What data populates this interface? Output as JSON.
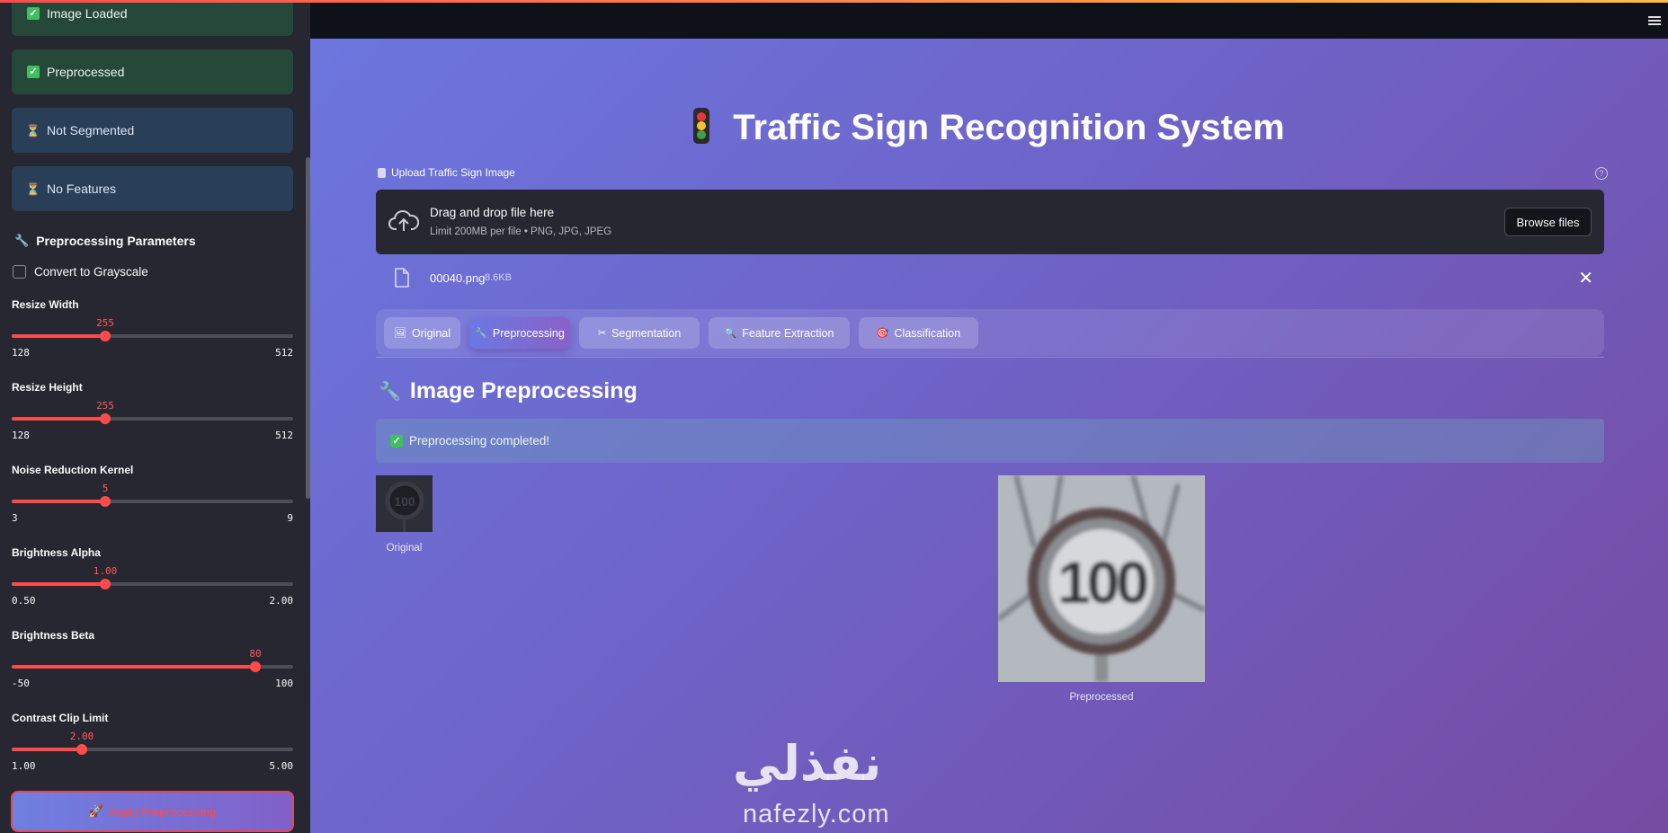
{
  "sidebar": {
    "status_cards": [
      {
        "label": "Image Loaded",
        "state": "done",
        "icon": "check-icon"
      },
      {
        "label": "Preprocessed",
        "state": "done",
        "icon": "check-icon"
      },
      {
        "label": "Not Segmented",
        "state": "pending",
        "icon": "hourglass-icon"
      },
      {
        "label": "No Features",
        "state": "pending",
        "icon": "hourglass-icon"
      }
    ],
    "params_heading": "Preprocessing Parameters",
    "grayscale_label": "Convert to Grayscale",
    "grayscale_checked": false,
    "sliders": [
      {
        "label": "Resize Width",
        "value": "255",
        "min": "128",
        "max": "512",
        "fraction": 0.331
      },
      {
        "label": "Resize Height",
        "value": "255",
        "min": "128",
        "max": "512",
        "fraction": 0.331
      },
      {
        "label": "Noise Reduction Kernel",
        "value": "5",
        "min": "3",
        "max": "9",
        "fraction": 0.333
      },
      {
        "label": "Brightness Alpha",
        "value": "1.00",
        "min": "0.50",
        "max": "2.00",
        "fraction": 0.333
      },
      {
        "label": "Brightness Beta",
        "value": "80",
        "min": "-50",
        "max": "100",
        "fraction": 0.867
      },
      {
        "label": "Contrast Clip Limit",
        "value": "2.00",
        "min": "1.00",
        "max": "5.00",
        "fraction": 0.25
      }
    ],
    "apply_button": "Apply Preprocessing"
  },
  "main": {
    "title": "Traffic Sign Recognition System",
    "uploader": {
      "label": "Upload Traffic Sign Image",
      "drop_title": "Drag and drop file here",
      "drop_limit": "Limit 200MB per file • PNG, JPG, JPEG",
      "browse_button": "Browse files",
      "file_name": "00040.png",
      "file_size": "8.6KB"
    },
    "tabs": [
      {
        "label": "Original",
        "icon": "image-icon",
        "active": false
      },
      {
        "label": "Preprocessing",
        "icon": "wrench-icon",
        "active": true
      },
      {
        "label": "Segmentation",
        "icon": "scissors-icon",
        "active": false
      },
      {
        "label": "Feature Extraction",
        "icon": "magnifier-icon",
        "active": false
      },
      {
        "label": "Classification",
        "icon": "target-icon",
        "active": false
      }
    ],
    "section_heading": "Image Preprocessing",
    "success_message": "Preprocessing completed!",
    "original_caption": "Original",
    "preprocessed_caption": "Preprocessed",
    "sign_text": "100"
  },
  "watermark": {
    "arabic": "نفذلي",
    "english": "nafezly.com"
  },
  "colors": {
    "accent": "#ff4b4b",
    "sidebar_bg": "#262730",
    "success": "#25483b",
    "pending": "#293e57"
  }
}
